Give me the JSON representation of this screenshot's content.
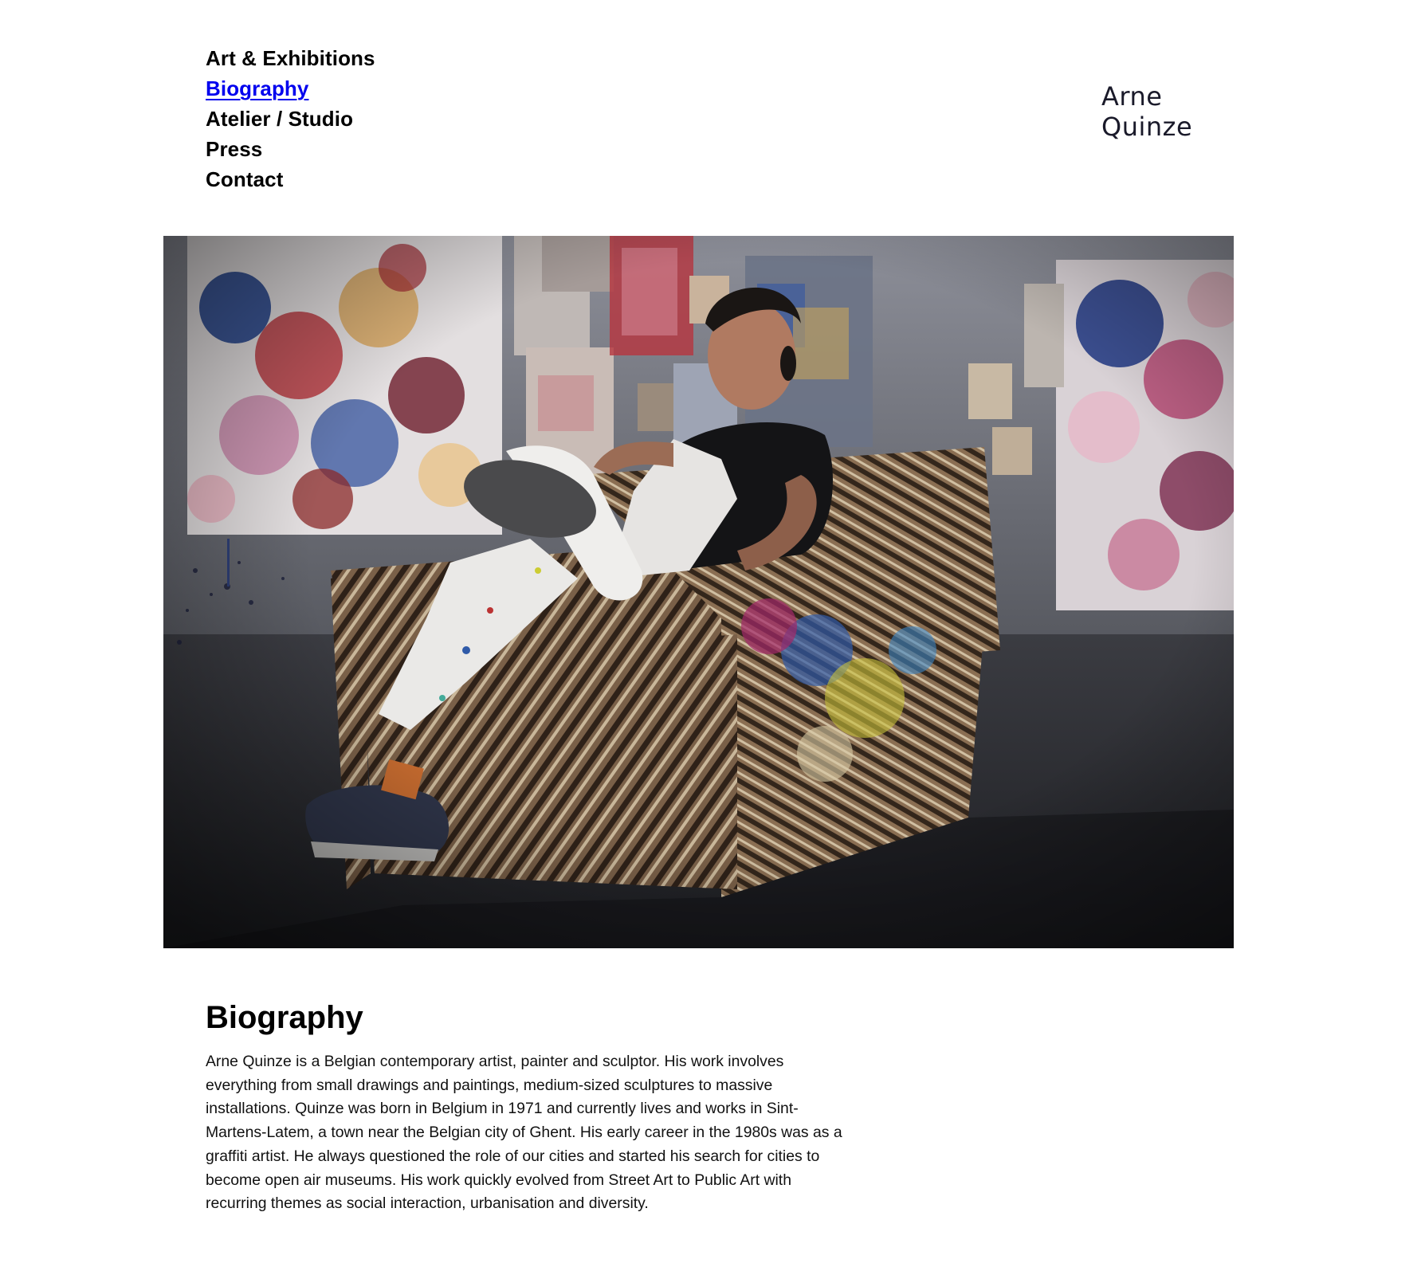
{
  "nav": {
    "items": [
      {
        "label": "Art & Exhibitions",
        "active": false
      },
      {
        "label": "Biography",
        "active": true
      },
      {
        "label": "Atelier / Studio",
        "active": false
      },
      {
        "label": "Press",
        "active": false
      },
      {
        "label": "Contact",
        "active": false
      }
    ]
  },
  "logo": {
    "line1": "Arne",
    "line2": "Quinze"
  },
  "photo": {
    "subject": "portrait of artist seated in paint-splattered armchair in studio"
  },
  "biography": {
    "title": "Biography",
    "text": "Arne Quinze is a Belgian contemporary artist, painter and sculptor. His work involves everything from small drawings and paintings, medium-sized sculptures to massive installations. Quinze was born in Belgium in 1971 and currently lives and works in Sint-Martens-Latem, a town near the Belgian city of Ghent. His early career in the 1980s was as a graffiti artist. He always questioned the role of our cities and started his search for cities to become open air museums. His work quickly evolved from Street Art to Public Art with recurring themes as social interaction, urbanisation and diversity."
  },
  "colors": {
    "link_active": "#0000ee",
    "text": "#000000",
    "background": "#ffffff"
  }
}
